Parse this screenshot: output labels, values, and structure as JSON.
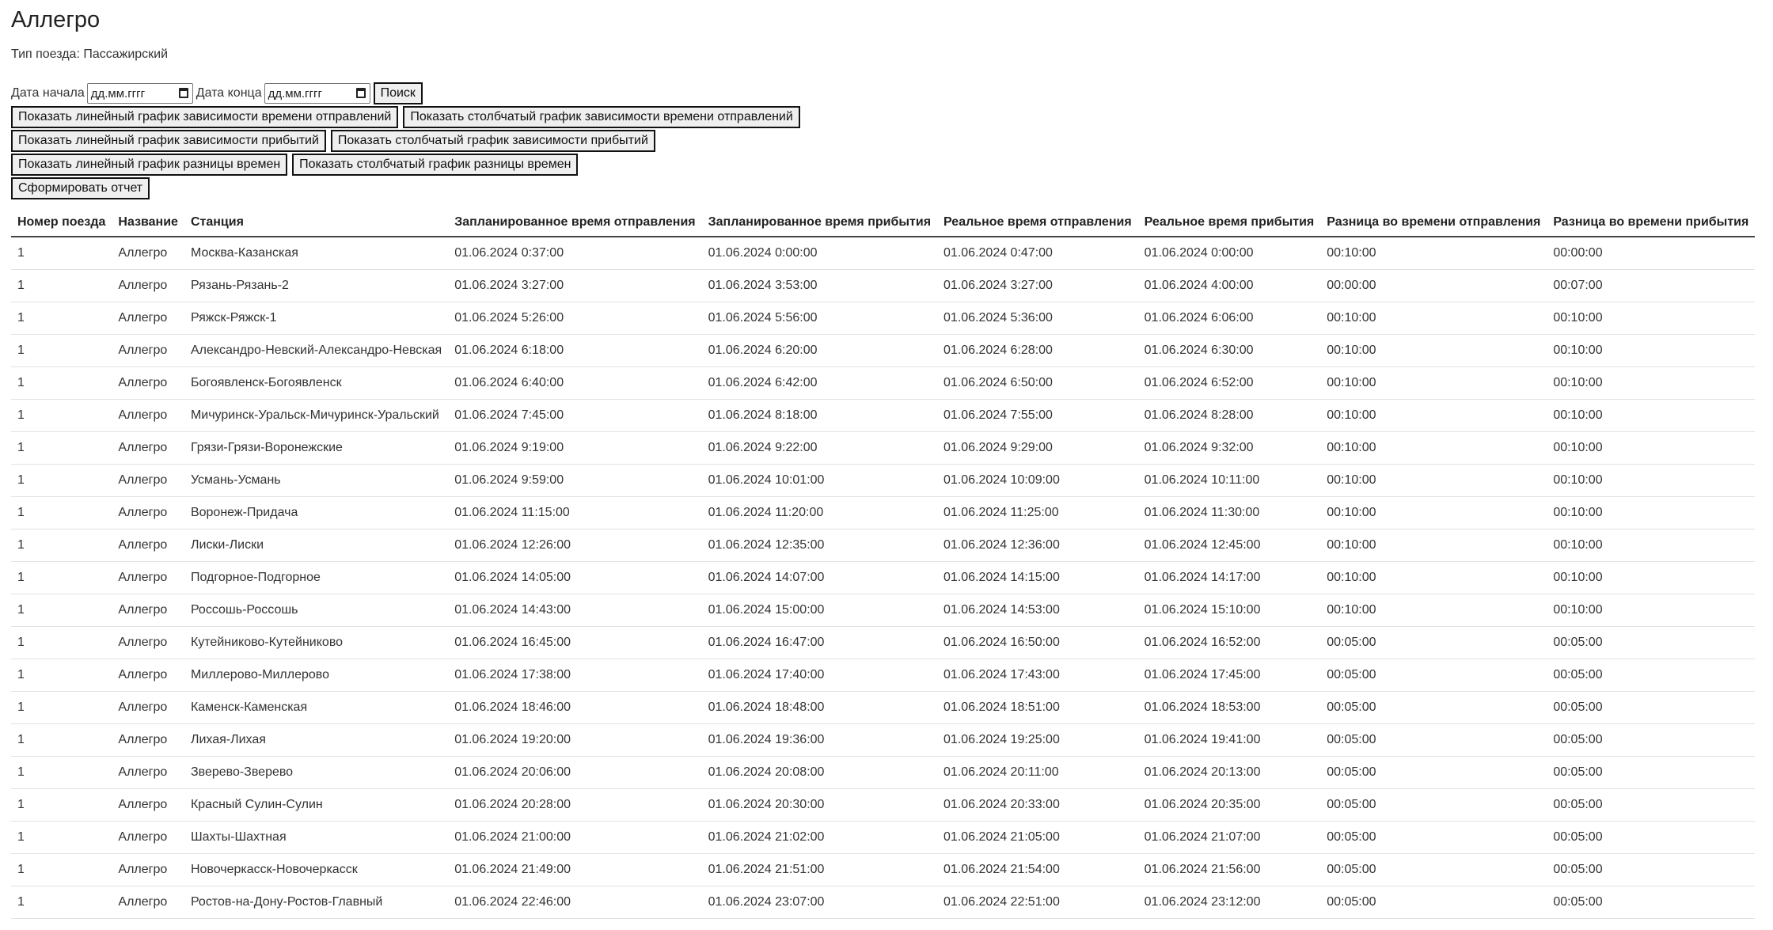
{
  "page": {
    "title": "Аллегро",
    "subtitle": "Тип поезда: Пассажирский"
  },
  "filters": {
    "start_label": "Дата начала",
    "start_value": "дд.мм.гггг",
    "end_label": "Дата конца",
    "end_value": "дд.мм.гггг",
    "search_button": "Поиск"
  },
  "buttons": {
    "line_departure": "Показать линейный график зависимости времени отправлений",
    "bar_departure": "Показать столбчатый график зависимости времени отправлений",
    "line_arrival": "Показать линейный график зависимости прибытий",
    "bar_arrival": "Показать столбчатый график зависимости прибытий",
    "line_diff": "Показать линейный график разницы времен",
    "bar_diff": "Показать столбчатый график разницы времен",
    "report": "Сформировать отчет"
  },
  "table": {
    "headers": [
      "Номер поезда",
      "Название",
      "Станция",
      "Запланированное время отправления",
      "Запланированное время прибытия",
      "Реальное время отправления",
      "Реальное время прибытия",
      "Разница во времени отправления",
      "Разница во времени прибытия"
    ],
    "rows": [
      [
        "1",
        "Аллегро",
        "Москва-Казанская",
        "01.06.2024 0:37:00",
        "01.06.2024 0:00:00",
        "01.06.2024 0:47:00",
        "01.06.2024 0:00:00",
        "00:10:00",
        "00:00:00"
      ],
      [
        "1",
        "Аллегро",
        "Рязань-Рязань-2",
        "01.06.2024 3:27:00",
        "01.06.2024 3:53:00",
        "01.06.2024 3:27:00",
        "01.06.2024 4:00:00",
        "00:00:00",
        "00:07:00"
      ],
      [
        "1",
        "Аллегро",
        "Ряжск-Ряжск-1",
        "01.06.2024 5:26:00",
        "01.06.2024 5:56:00",
        "01.06.2024 5:36:00",
        "01.06.2024 6:06:00",
        "00:10:00",
        "00:10:00"
      ],
      [
        "1",
        "Аллегро",
        "Александро-Невский-Александро-Невская",
        "01.06.2024 6:18:00",
        "01.06.2024 6:20:00",
        "01.06.2024 6:28:00",
        "01.06.2024 6:30:00",
        "00:10:00",
        "00:10:00"
      ],
      [
        "1",
        "Аллегро",
        "Богоявленск-Богоявленск",
        "01.06.2024 6:40:00",
        "01.06.2024 6:42:00",
        "01.06.2024 6:50:00",
        "01.06.2024 6:52:00",
        "00:10:00",
        "00:10:00"
      ],
      [
        "1",
        "Аллегро",
        "Мичуринск-Уральск-Мичуринск-Уральский",
        "01.06.2024 7:45:00",
        "01.06.2024 8:18:00",
        "01.06.2024 7:55:00",
        "01.06.2024 8:28:00",
        "00:10:00",
        "00:10:00"
      ],
      [
        "1",
        "Аллегро",
        "Грязи-Грязи-Воронежские",
        "01.06.2024 9:19:00",
        "01.06.2024 9:22:00",
        "01.06.2024 9:29:00",
        "01.06.2024 9:32:00",
        "00:10:00",
        "00:10:00"
      ],
      [
        "1",
        "Аллегро",
        "Усмань-Усмань",
        "01.06.2024 9:59:00",
        "01.06.2024 10:01:00",
        "01.06.2024 10:09:00",
        "01.06.2024 10:11:00",
        "00:10:00",
        "00:10:00"
      ],
      [
        "1",
        "Аллегро",
        "Воронеж-Придача",
        "01.06.2024 11:15:00",
        "01.06.2024 11:20:00",
        "01.06.2024 11:25:00",
        "01.06.2024 11:30:00",
        "00:10:00",
        "00:10:00"
      ],
      [
        "1",
        "Аллегро",
        "Лиски-Лиски",
        "01.06.2024 12:26:00",
        "01.06.2024 12:35:00",
        "01.06.2024 12:36:00",
        "01.06.2024 12:45:00",
        "00:10:00",
        "00:10:00"
      ],
      [
        "1",
        "Аллегро",
        "Подгорное-Подгорное",
        "01.06.2024 14:05:00",
        "01.06.2024 14:07:00",
        "01.06.2024 14:15:00",
        "01.06.2024 14:17:00",
        "00:10:00",
        "00:10:00"
      ],
      [
        "1",
        "Аллегро",
        "Россошь-Россошь",
        "01.06.2024 14:43:00",
        "01.06.2024 15:00:00",
        "01.06.2024 14:53:00",
        "01.06.2024 15:10:00",
        "00:10:00",
        "00:10:00"
      ],
      [
        "1",
        "Аллегро",
        "Кутейниково-Кутейниково",
        "01.06.2024 16:45:00",
        "01.06.2024 16:47:00",
        "01.06.2024 16:50:00",
        "01.06.2024 16:52:00",
        "00:05:00",
        "00:05:00"
      ],
      [
        "1",
        "Аллегро",
        "Миллерово-Миллерово",
        "01.06.2024 17:38:00",
        "01.06.2024 17:40:00",
        "01.06.2024 17:43:00",
        "01.06.2024 17:45:00",
        "00:05:00",
        "00:05:00"
      ],
      [
        "1",
        "Аллегро",
        "Каменск-Каменская",
        "01.06.2024 18:46:00",
        "01.06.2024 18:48:00",
        "01.06.2024 18:51:00",
        "01.06.2024 18:53:00",
        "00:05:00",
        "00:05:00"
      ],
      [
        "1",
        "Аллегро",
        "Лихая-Лихая",
        "01.06.2024 19:20:00",
        "01.06.2024 19:36:00",
        "01.06.2024 19:25:00",
        "01.06.2024 19:41:00",
        "00:05:00",
        "00:05:00"
      ],
      [
        "1",
        "Аллегро",
        "Зверево-Зверево",
        "01.06.2024 20:06:00",
        "01.06.2024 20:08:00",
        "01.06.2024 20:11:00",
        "01.06.2024 20:13:00",
        "00:05:00",
        "00:05:00"
      ],
      [
        "1",
        "Аллегро",
        "Красный Сулин-Сулин",
        "01.06.2024 20:28:00",
        "01.06.2024 20:30:00",
        "01.06.2024 20:33:00",
        "01.06.2024 20:35:00",
        "00:05:00",
        "00:05:00"
      ],
      [
        "1",
        "Аллегро",
        "Шахты-Шахтная",
        "01.06.2024 21:00:00",
        "01.06.2024 21:02:00",
        "01.06.2024 21:05:00",
        "01.06.2024 21:07:00",
        "00:05:00",
        "00:05:00"
      ],
      [
        "1",
        "Аллегро",
        "Новочеркасск-Новочеркасск",
        "01.06.2024 21:49:00",
        "01.06.2024 21:51:00",
        "01.06.2024 21:54:00",
        "01.06.2024 21:56:00",
        "00:05:00",
        "00:05:00"
      ],
      [
        "1",
        "Аллегро",
        "Ростов-на-Дону-Ростов-Главный",
        "01.06.2024 22:46:00",
        "01.06.2024 23:07:00",
        "01.06.2024 22:51:00",
        "01.06.2024 23:12:00",
        "00:05:00",
        "00:05:00"
      ]
    ]
  }
}
